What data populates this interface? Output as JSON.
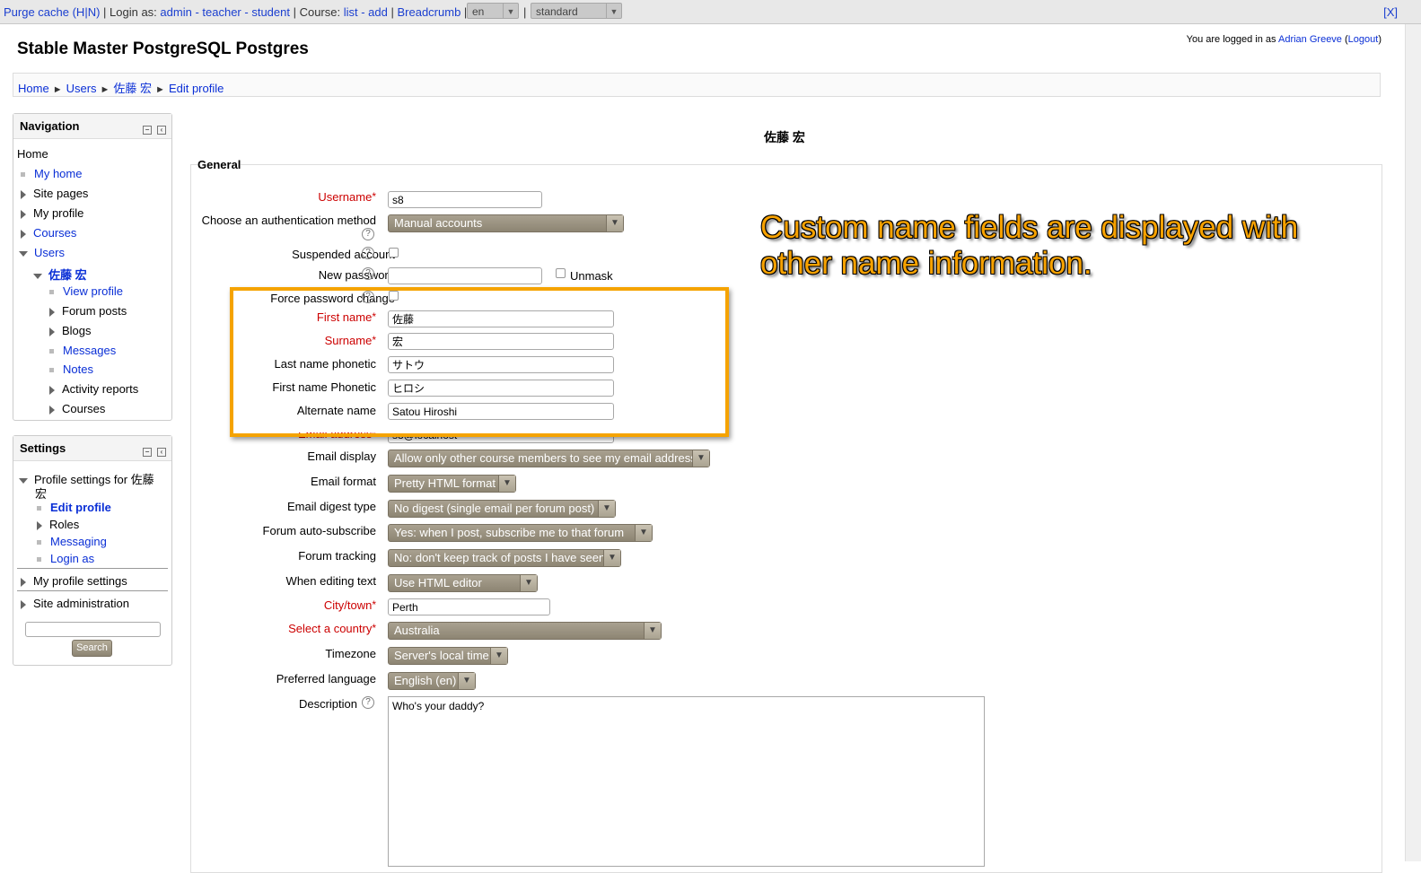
{
  "topbar": {
    "purge": "Purge cache (H|N)",
    "sep1": " | Login as: ",
    "admin": "admin",
    "teacher": "teacher",
    "student": "student",
    "sep2": " | Course: ",
    "list": "list",
    "add": "add",
    "breadcrumb": "Breadcrumb",
    "lang": "en",
    "theme": "standard",
    "close": "[X]"
  },
  "site_title": "Stable Master PostgreSQL Postgres",
  "login": {
    "prefix": "You are logged in as ",
    "user": "Adrian Greeve",
    "logout": "Logout"
  },
  "breadcrumb": [
    "Home",
    "Users",
    "佐藤 宏",
    "Edit profile"
  ],
  "navigation": {
    "title": "Navigation",
    "home": "Home",
    "my_home": "My home",
    "site_pages": "Site pages",
    "my_profile": "My profile",
    "courses": "Courses",
    "users": "Users",
    "user_name": "佐藤 宏",
    "view_profile": "View profile",
    "forum_posts": "Forum posts",
    "blogs": "Blogs",
    "messages": "Messages",
    "notes": "Notes",
    "activity_reports": "Activity reports",
    "user_courses": "Courses"
  },
  "settings": {
    "title": "Settings",
    "profile_settings_line1": "Profile settings for 佐藤",
    "profile_settings_line2": "宏",
    "edit_profile": "Edit profile",
    "roles": "Roles",
    "messaging": "Messaging",
    "login_as": "Login as",
    "my_profile_settings": "My profile settings",
    "site_admin": "Site administration",
    "search_button": "Search"
  },
  "page_heading": "佐藤 宏",
  "form": {
    "legend": "General",
    "username_label": "Username",
    "username": "s8",
    "auth_label": "Choose an authentication method",
    "auth": "Manual accounts",
    "suspended_label": "Suspended account",
    "new_password_label": "New password",
    "unmask": "Unmask",
    "force_pw_label": "Force password change",
    "firstname_label": "First name",
    "firstname": "佐藤",
    "surname_label": "Surname",
    "surname": "宏",
    "lastphonetic_label": "Last name phonetic",
    "lastphonetic": "サトウ",
    "firstphonetic_label": "First name Phonetic",
    "firstphonetic": "ヒロシ",
    "altname_label": "Alternate name",
    "altname": "Satou Hiroshi",
    "email_label": "Email address",
    "email": "s8@localhost",
    "email_display_label": "Email display",
    "email_display": "Allow only other course members to see my email address",
    "email_format_label": "Email format",
    "email_format": "Pretty HTML format",
    "digest_label": "Email digest type",
    "digest": "No digest (single email per forum post)",
    "autosub_label": "Forum auto-subscribe",
    "autosub": "Yes: when I post, subscribe me to that forum",
    "tracking_label": "Forum tracking",
    "tracking": "No: don't keep track of posts I have seen",
    "editing_label": "When editing text",
    "editing": "Use HTML editor",
    "city_label": "City/town",
    "city": "Perth",
    "country_label": "Select a country",
    "country": "Australia",
    "timezone_label": "Timezone",
    "timezone": "Server's local time",
    "lang_label": "Preferred language",
    "lang": "English (en)",
    "desc_label": "Description",
    "desc": "Who's your daddy?"
  },
  "callout": {
    "line1": "Custom name fields are displayed with",
    "line2": "other name information."
  },
  "colors": {
    "highlight": "#f5a300",
    "required": "#cc0000",
    "link": "#0a2fd6"
  }
}
